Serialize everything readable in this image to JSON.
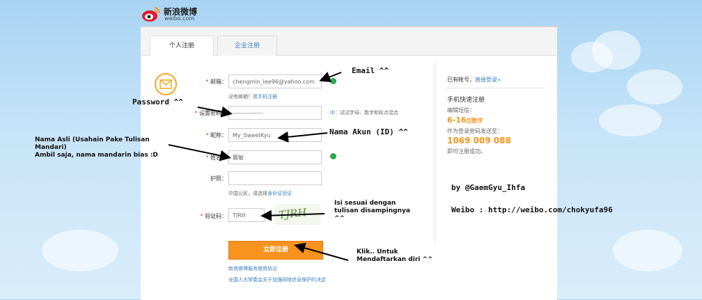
{
  "logo": {
    "cn": "新浪微博",
    "en": "weibo.com"
  },
  "tabs": [
    {
      "label": "个人注册",
      "active": true
    },
    {
      "label": "企业注册",
      "active": false
    }
  ],
  "form": {
    "email": {
      "label": "邮箱：",
      "value": "chengmin_lee96@yahoo.com"
    },
    "no_email": {
      "text": "没有邮箱？",
      "link": "用手机注册"
    },
    "password": {
      "label": "设置密码：",
      "value": "---------------",
      "hint_prefix": "中",
      "hint": "：试试字母、数字和标点混合"
    },
    "nickname": {
      "label": "昵称：",
      "value": "My_SweetKyu"
    },
    "realname": {
      "label": "姓名：",
      "value": "晨敏"
    },
    "id": {
      "label": "护照：",
      "value": ""
    },
    "id_hint": {
      "text": "中国公民，请选择",
      "link": "身份证验证"
    },
    "captcha": {
      "label": "验证码：",
      "value": "TJRH",
      "image_text": "TJRH"
    },
    "submit_label": "立即注册",
    "agreement_link": "新浪微博服务使用协议",
    "law_link": "全国人大常委会关于加强网络信息保护的决定"
  },
  "sidebar": {
    "has_account": "已有帐号，",
    "login_link": "直接登录»",
    "quick_title": "手机快速注册",
    "sms_label": "编辑短信：",
    "digits_bold": "6-16",
    "digits_suffix": "位数字",
    "send_label": "作为登录密码发送至：",
    "phone": "1069 009 088",
    "done": "即可注册成功。"
  },
  "annotations": {
    "email": "Email ^^",
    "password": "Password ^^",
    "nama_asli": [
      "Nama Asli (Usahain Pake Tulisan",
      "Mandari)",
      "Ambil saja, nama mandarin bias :D"
    ],
    "nama_akun": "Nama Akun (ID) ^^",
    "isi_sesuai": [
      "Isi sesuai dengan",
      "tulisan disampingnya",
      "^^"
    ],
    "klik": [
      "Klik.. Untuk",
      "Mendaftarkan diri ^^"
    ],
    "credit": "by @GaemGyu_Ihfa",
    "weibo": "Weibo : http://weibo.com/chokyufa96"
  },
  "colors": {
    "accent": "#f7931e",
    "link": "#3c7dbd",
    "required": "#e4393c",
    "ok": "#2da84c"
  }
}
